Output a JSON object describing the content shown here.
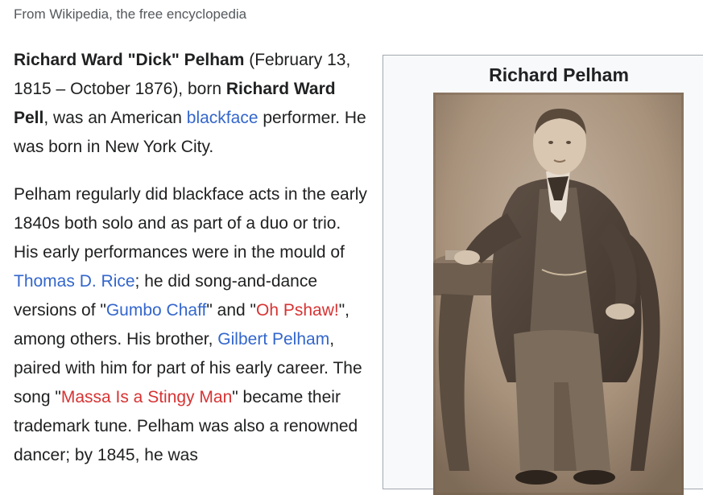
{
  "tagline": "From Wikipedia, the free encyclopedia",
  "para1": {
    "name": "Richard Ward \"Dick\" Pelham",
    "dates": " (February 13, 1815 – October 1876), born ",
    "birth_name": "Richard Ward Pell",
    "t1": ", was an American ",
    "link_blackface": "blackface",
    "t2": " performer. He was born in New York City."
  },
  "para2": {
    "t1": "Pelham regularly did blackface acts in the early 1840s both solo and as part of a duo or trio. His early performances were in the mould of ",
    "link_rice": "Thomas D. Rice",
    "t2": "; he did song-and-dance versions of \"",
    "link_gumbo": "Gumbo Chaff",
    "t3": "\" and \"",
    "link_ohpshaw": "Oh Pshaw!",
    "t4": "\", among others. His brother, ",
    "link_gilbert": "Gilbert Pelham",
    "t5": ", paired with him for part of his early career. The song \"",
    "link_massa": "Massa Is a Stingy Man",
    "t6": "\" became their trademark tune. Pelham was also a renowned dancer; by 1845, he was"
  },
  "infobox": {
    "title": "Richard Pelham"
  },
  "colors": {
    "link": "#3366cc",
    "redlink": "#d73333",
    "text": "#202122",
    "infobox_bg": "#f8f9fa",
    "sepia": "#a08c78"
  }
}
